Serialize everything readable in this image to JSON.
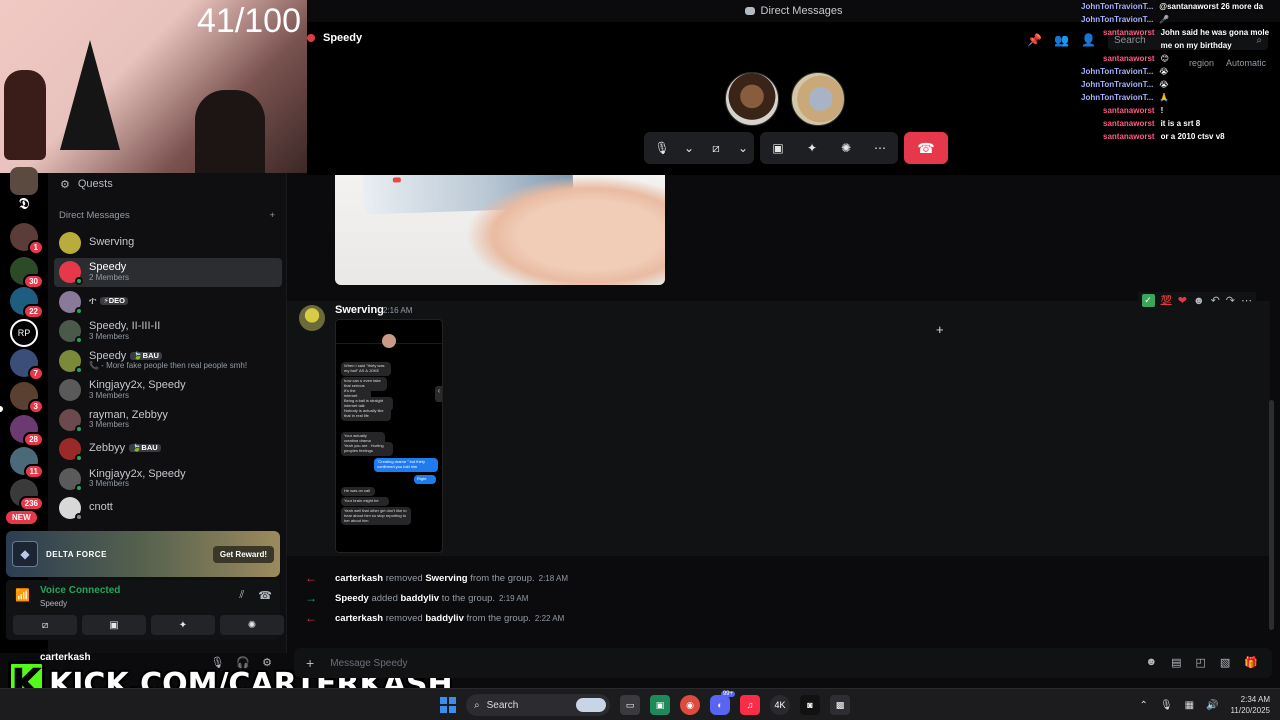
{
  "window": {
    "title": "Direct Messages"
  },
  "call": {
    "group_name": "Speedy",
    "search_placeholder": "Search",
    "region_label": "region",
    "region_value": "Automatic"
  },
  "webcam": {
    "counter": "41/100"
  },
  "rail": {
    "badges": [
      "1",
      "30",
      "22",
      "7",
      "3",
      "28",
      "11",
      "236"
    ],
    "new_label": "NEW"
  },
  "sidebar": {
    "quests_label": "Quests",
    "dm_header": "Direct Messages",
    "dms": [
      {
        "name": "Swerving",
        "sub": "",
        "tag": ""
      },
      {
        "name": "Speedy",
        "sub": "2 Members",
        "tag": ""
      },
      {
        "name": "ተ",
        "sub": "",
        "tag": "⚡DEO"
      },
      {
        "name": "Speedy, II-III-II",
        "sub": "3 Members",
        "tag": ""
      },
      {
        "name": "Speedy",
        "sub": "📞 - More fake people then real people smh!",
        "tag": "🍃BAU"
      },
      {
        "name": "Kingjayy2x, Speedy",
        "sub": "3 Members",
        "tag": ""
      },
      {
        "name": "rayman, Zebbyy",
        "sub": "3 Members",
        "tag": ""
      },
      {
        "name": "Zebbyy",
        "sub": "",
        "tag": "🍃BAU"
      },
      {
        "name": "Kingjayy2x, Speedy",
        "sub": "3 Members",
        "tag": ""
      },
      {
        "name": "cnott",
        "sub": "",
        "tag": ""
      }
    ]
  },
  "promo": {
    "title": "DELTA FORCE",
    "button": "Get Reward!"
  },
  "voice": {
    "status": "Voice Connected",
    "channel": "Speedy"
  },
  "user": {
    "name": "carterkash"
  },
  "kick": {
    "letter": "K",
    "text": "KICK.COM/CARTERKASH"
  },
  "message": {
    "author": "Swerving",
    "time": "2:16 AM",
    "phone_bubbles": [
      "When I said \"thirty was my bail\" AS A JOKE",
      "how can u even take that serious",
      "It's the internet",
      "Being a ball is straight internet talk",
      "Nobody is actually like that in real life",
      "Your actually creating drama",
      "Yeah you are . Hurting peoples feelings",
      "\"Creating drama \" but thirty confirmed you told him",
      "Right",
      "He was on call",
      "Your brain might be",
      "Yeah well that other girl don't like to hear about him so stop reporting to her about him"
    ]
  },
  "system_messages": [
    {
      "kind": "remove",
      "actor": "carterkash",
      "verb": "removed",
      "target": "Swerving",
      "tail": "from the group.",
      "time": "2:18 AM"
    },
    {
      "kind": "add",
      "actor": "Speedy",
      "verb": "added",
      "target": "baddyliv",
      "tail": "to the group.",
      "time": "2:19 AM"
    },
    {
      "kind": "remove",
      "actor": "carterkash",
      "verb": "removed",
      "target": "baddyliv",
      "tail": "from the group.",
      "time": "2:22 AM"
    }
  ],
  "composer": {
    "placeholder": "Message Speedy"
  },
  "stream_chat": [
    {
      "user": "JohnTonTravionT...",
      "msg": "@santanaworst 26 more da",
      "style": "john"
    },
    {
      "user": "JohnTonTravionT...",
      "msg": "🎤",
      "style": "john"
    },
    {
      "user": "santanaworst",
      "msg": "John said he was gona mole me on my birthday",
      "style": "santa"
    },
    {
      "user": "santanaworst",
      "msg": "😊",
      "style": "santa"
    },
    {
      "user": "JohnTonTravionT...",
      "msg": "😭",
      "style": "john"
    },
    {
      "user": "JohnTonTravionT...",
      "msg": "😭",
      "style": "john"
    },
    {
      "user": "JohnTonTravionT...",
      "msg": "🙏",
      "style": "john"
    },
    {
      "user": "santanaworst",
      "msg": "!",
      "style": "santa"
    },
    {
      "user": "santanaworst",
      "msg": "it is a srt 8",
      "style": "santa"
    },
    {
      "user": "santanaworst",
      "msg": "or a 2010 ctsv v8",
      "style": "santa"
    }
  ],
  "taskbar": {
    "search_label": "Search",
    "discord_badge": "99+",
    "clock_time": "2:34 AM",
    "clock_date": "11/20/2025"
  },
  "colors": {
    "accent_red": "#e5394b",
    "online_green": "#23a55a",
    "kick_green": "#53fc18"
  }
}
